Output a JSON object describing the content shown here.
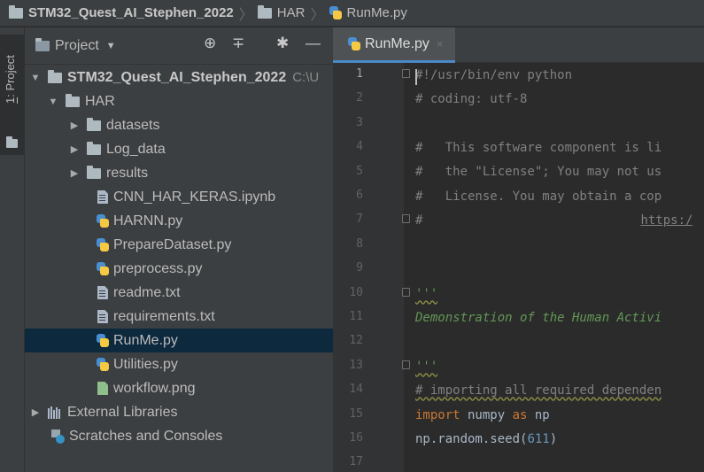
{
  "breadcrumb": {
    "project": "STM32_Quest_AI_Stephen_2022",
    "folder": "HAR",
    "file": "RunMe.py"
  },
  "toolstrip": {
    "project_tab_number": "1",
    "project_tab_label": ": Project"
  },
  "project_panel": {
    "title": "Project",
    "icons": [
      "crosshair-icon",
      "collapse-icon",
      "gear-icon",
      "minimize-icon"
    ],
    "tree": [
      {
        "label": "STM32_Quest_AI_Stephen_2022",
        "hint": "C:\\U",
        "type": "folder",
        "expanded": true
      },
      {
        "label": "HAR",
        "type": "folder",
        "expanded": true
      },
      {
        "label": "datasets",
        "type": "folder",
        "expanded": false
      },
      {
        "label": "Log_data",
        "type": "folder",
        "expanded": false
      },
      {
        "label": "results",
        "type": "folder",
        "expanded": false
      },
      {
        "label": "CNN_HAR_KERAS.ipynb",
        "type": "text"
      },
      {
        "label": "HARNN.py",
        "type": "python"
      },
      {
        "label": "PrepareDataset.py",
        "type": "python"
      },
      {
        "label": "preprocess.py",
        "type": "python"
      },
      {
        "label": "readme.txt",
        "type": "text"
      },
      {
        "label": "requirements.txt",
        "type": "text"
      },
      {
        "label": "RunMe.py",
        "type": "python",
        "selected": true
      },
      {
        "label": "Utilities.py",
        "type": "python"
      },
      {
        "label": "workflow.png",
        "type": "image"
      },
      {
        "label": "External Libraries",
        "type": "library",
        "expanded": false
      },
      {
        "label": "Scratches and Consoles",
        "type": "scratch"
      }
    ]
  },
  "editor": {
    "tab_label": "RunMe.py",
    "tab_close": "×",
    "line_numbers": [
      "1",
      "2",
      "3",
      "4",
      "5",
      "6",
      "7",
      "8",
      "9",
      "10",
      "11",
      "12",
      "13",
      "14",
      "15",
      "16",
      "17"
    ],
    "lines": {
      "l1": "#!/usr/bin/env python",
      "l2": "# coding: utf-8",
      "l4": "#   This software component is li",
      "l5": "#   the \"License\"; You may not us",
      "l6": "#   License. You may obtain a cop",
      "l7_hash": "#",
      "l7_link": "https:/",
      "l10": "'''",
      "l11": "Demonstration of the Human Activi",
      "l13": "'''",
      "l14": "# importing all required dependen",
      "l15_kw1": "import",
      "l15_mod": " numpy ",
      "l15_kw2": "as",
      "l15_alias": " np",
      "l16_call": "np.random.seed(",
      "l16_num": "611",
      "l16_end": ")"
    }
  }
}
